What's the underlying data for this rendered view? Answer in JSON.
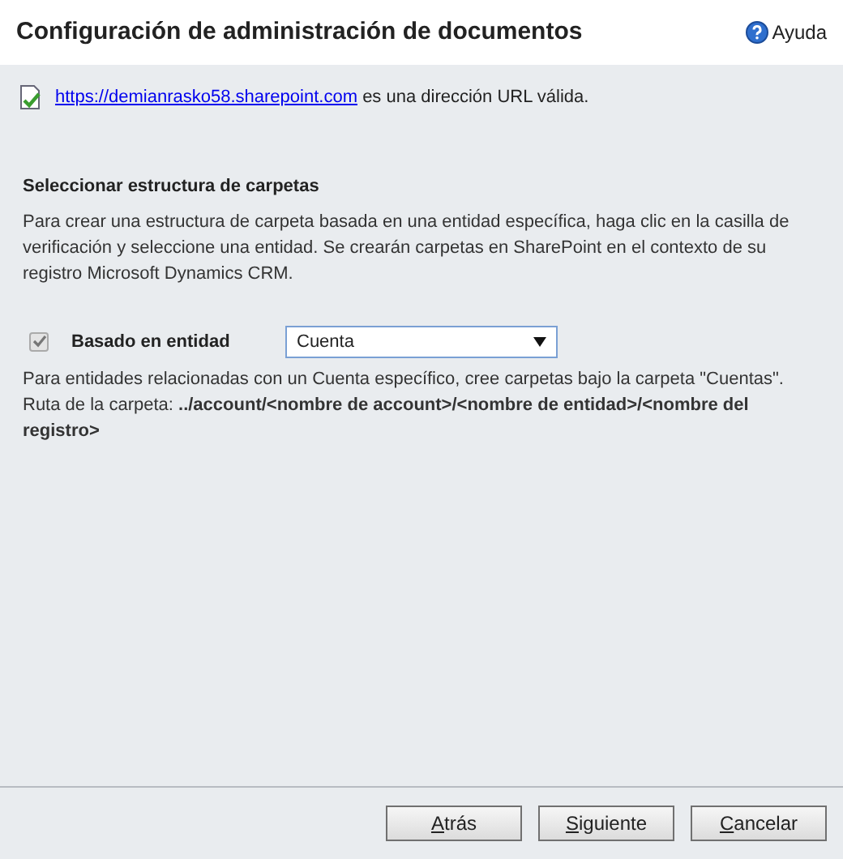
{
  "window": {
    "title": "Configuración de administración de documentos",
    "help": "Ayuda"
  },
  "url_status": {
    "link": "https://demianrasko58.sharepoint.com",
    "message": "es una dirección URL válida."
  },
  "section": {
    "heading": "Seleccionar estructura de carpetas",
    "description": "Para crear una estructura de carpeta basada en una entidad específica, haga clic en la casilla de verificación y seleccione una entidad. Se crearán carpetas en SharePoint en el contexto de su registro Microsoft Dynamics CRM.",
    "option": {
      "label": "Basado en entidad",
      "checked": true,
      "disabled": true
    },
    "entity": {
      "value": "Cuenta"
    },
    "note": "Para entidades relacionadas con un Cuenta específico, cree carpetas bajo la carpeta \"Cuentas\".",
    "path": "Ruta de la carpeta: **../account/<nombre de account>/<nombre de entidad>/<nombre del registro>**"
  },
  "buttons": [
    "Atrás",
    "Siguiente",
    "Cancelar"
  ]
}
